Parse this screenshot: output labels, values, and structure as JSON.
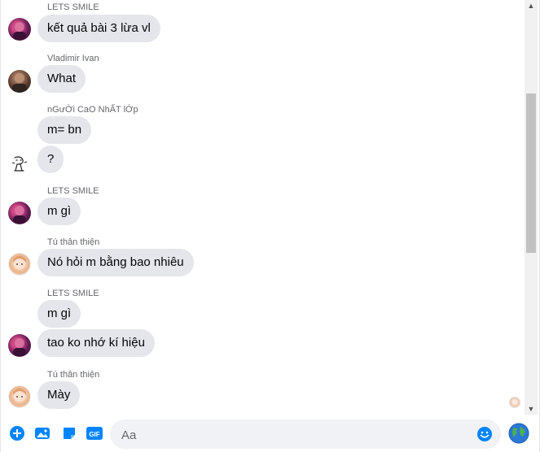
{
  "messages": [
    {
      "sender": "LETS SMILE",
      "avatar": "purple-avatar",
      "texts": [
        "kết quả bài 3 lừa vl"
      ]
    },
    {
      "sender": "Vladimir Ivan",
      "avatar": "brown-avatar",
      "texts": [
        "What"
      ]
    },
    {
      "sender": "nGưỜi CaO NhẤT lỚp",
      "avatar": "sketch-avatar",
      "texts": [
        "m= bn",
        "?"
      ]
    },
    {
      "sender": "LETS SMILE",
      "avatar": "purple-avatar",
      "texts": [
        "m gì"
      ]
    },
    {
      "sender": "Tú thân thiện",
      "avatar": "anime-avatar",
      "texts": [
        "Nó hỏi m bằng bao nhiêu"
      ]
    },
    {
      "sender": "LETS SMILE",
      "avatar": "purple-avatar",
      "texts": [
        "m gì",
        "tao ko nhớ kí hiệu"
      ]
    },
    {
      "sender": "Tú thân thiện",
      "avatar": "anime-avatar",
      "texts": [
        "Mày"
      ]
    }
  ],
  "composer": {
    "placeholder": "Aa",
    "icons": [
      "plus-icon",
      "image-icon",
      "sticker-icon",
      "gif-icon",
      "emoji-icon",
      "globe-icon"
    ],
    "gif_label": "GIF"
  },
  "colors": {
    "accent": "#0084ff",
    "bubble": "#e4e6eb"
  }
}
